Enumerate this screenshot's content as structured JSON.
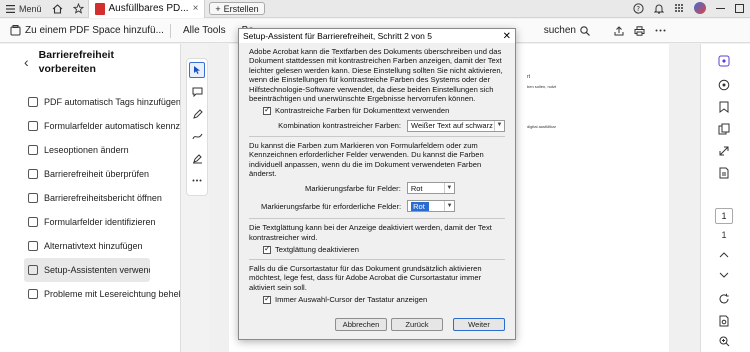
{
  "topbar": {
    "menu_label": "Menü",
    "tab_title": "Ausfüllbares PD...",
    "new_tab_label": "Erstellen"
  },
  "toolbar": {
    "space_label": "Zu einem PDF Space hinzufü...",
    "all_tools": "Alle Tools",
    "edit_label": "Be",
    "search_label": "suchen"
  },
  "left_panel": {
    "title_line1": "Barrierefreiheit",
    "title_line2": "vorbereiten",
    "items": [
      {
        "label": "PDF automatisch Tags hinzufügen"
      },
      {
        "label": "Formularfelder automatisch kennzeichne"
      },
      {
        "label": "Leseoptionen ändern"
      },
      {
        "label": "Barrierefreiheit überprüfen"
      },
      {
        "label": "Barrierefreiheitsbericht öffnen"
      },
      {
        "label": "Formularfelder identifizieren"
      },
      {
        "label": "Alternativtext hinzufügen"
      },
      {
        "label": "Setup-Assistenten verwenden"
      },
      {
        "label": "Probleme mit Lesereichtung beheben"
      }
    ]
  },
  "document": {
    "snippet1": "rt",
    "snippet2": "ben sollen, nutzt",
    "snippet3": "digital ausfüllbar"
  },
  "right_rail": {
    "page_box": "1",
    "page_number": "1"
  },
  "dialog": {
    "title": "Setup-Assistent für Barrierefreiheit, Schritt 2 von 5",
    "intro": "Adobe Acrobat kann die Textfarben des Dokuments überschreiben und das Dokument stattdessen mit kontrastreichen Farben anzeigen, damit der Text leichter gelesen werden kann. Diese Einstellung sollten Sie nicht aktivieren, wenn die Einstellungen für kontrastreiche Farben des Systems oder der Hilfstechnologie-Software verwendet, da diese beiden Einstellungen sich beeinträchtigen und unerwünschte Ergebnisse hervorrufen können.",
    "contrast_checkbox": "Kontrastreiche Farben für Dokumenttext verwenden",
    "combo_label": "Kombination kontrastreicher Farben:",
    "combo_value": "Weißer Text auf schwarz",
    "fields_intro": "Du kannst die Farben zum Markieren von Formularfeldern oder zum Kennzeichnen erforderlicher Felder verwenden. Du kannst die Farben individuell anpassen, wenn du die im Dokument verwendeten Farben änderst.",
    "field_color_label": "Markierungsfarbe für Felder:",
    "field_color_value": "Rot",
    "required_color_label": "Markierungsfarbe für erforderliche Felder:",
    "required_color_value": "Rot",
    "smoothing_intro": "Die Textglättung kann bei der Anzeige deaktiviert werden, damit der Text kontrastreicher wird.",
    "smoothing_checkbox": "Textglättung deaktivieren",
    "cursor_intro": "Falls du die Cursortastatur für das Dokument grundsätzlich aktivieren möchtest, lege fest, dass für Adobe Acrobat die Cursortastatur immer aktiviert sein soll.",
    "cursor_checkbox": "Immer Auswahl-Cursor der Tastatur anzeigen",
    "btn_cancel": "Abbrechen",
    "btn_back": "Zurück",
    "btn_next": "Weiter"
  }
}
